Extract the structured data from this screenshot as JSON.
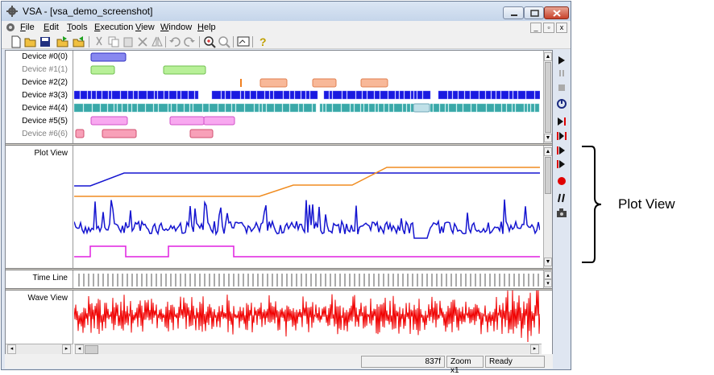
{
  "window": {
    "title": "VSA - [vsa_demo_screenshot]",
    "app_icon": "gear-icon"
  },
  "menu": [
    {
      "label": "File",
      "key": "F",
      "rest": "ile"
    },
    {
      "label": "Edit",
      "key": "E",
      "rest": "dit"
    },
    {
      "label": "Tools",
      "key": "T",
      "rest": "ools"
    },
    {
      "label": "Execution",
      "key": "E",
      "rest": "xecution"
    },
    {
      "label": "View",
      "key": "V",
      "rest": "iew"
    },
    {
      "label": "Window",
      "key": "W",
      "rest": "indow"
    },
    {
      "label": "Help",
      "key": "H",
      "rest": "elp"
    }
  ],
  "toolbar_icons": [
    "new-file-icon",
    "open-folder-icon",
    "save-icon",
    "export-icon",
    "import-icon",
    "cut-icon",
    "copy-icon",
    "paste-icon",
    "delete-icon",
    "mirror-icon",
    "undo-icon",
    "redo-icon",
    "zoom-in-icon",
    "zoom-out-icon",
    "view-icon",
    "help-icon"
  ],
  "devices": [
    {
      "label": "Device #0(0)",
      "enabled": true,
      "color": "#6666ee"
    },
    {
      "label": "Device #1(1)",
      "enabled": false,
      "color": "#99ee66"
    },
    {
      "label": "Device #2(2)",
      "enabled": true,
      "color": "#f4a070"
    },
    {
      "label": "Device #3(3)",
      "enabled": true,
      "color": "#1a1ae0"
    },
    {
      "label": "Device #4(4)",
      "enabled": true,
      "color": "#3aa8a8"
    },
    {
      "label": "Device #5(5)",
      "enabled": true,
      "color": "#f070e8"
    },
    {
      "label": "Device #6(6)",
      "enabled": false,
      "color": "#f07090"
    }
  ],
  "panes": {
    "plot_view": "Plot View",
    "time_line": "Time Line",
    "wave_view": "Wave View"
  },
  "plot_colors": {
    "blue": "#1515d0",
    "orange": "#f08c20",
    "magenta": "#e020e0",
    "wave": "#f00000"
  },
  "status": {
    "frame": "837f",
    "zoom": "Zoom x1",
    "state": "Ready"
  },
  "right_toolbar_icons": [
    "play-icon",
    "pause-icon",
    "stop-icon",
    "reset-icon",
    "step-end-icon",
    "step-back-icon",
    "step-forward-icon",
    "play-step-icon",
    "record-icon",
    "break-icon",
    "camera-icon"
  ],
  "annotation": {
    "label": "Plot View"
  }
}
